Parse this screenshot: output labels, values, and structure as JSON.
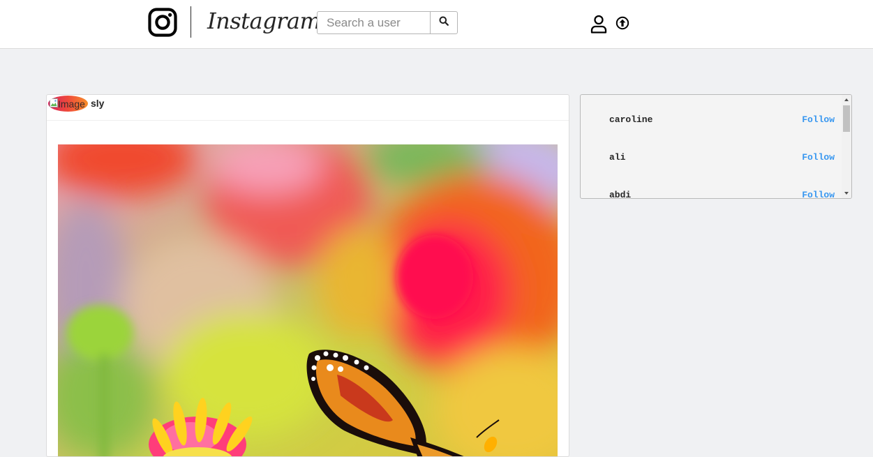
{
  "header": {
    "brand": "Instagram",
    "logo_icon": "instagram-camera-icon",
    "search": {
      "placeholder": "Search a user",
      "value": "",
      "button_icon": "search-icon"
    },
    "nav_icons": [
      "user-profile-icon",
      "upload-arrow-icon"
    ]
  },
  "post": {
    "avatar_alt": "Image",
    "username": "sly",
    "image_subject": "butterfly-on-flowers-photo"
  },
  "suggestions": {
    "users": [
      {
        "name": "caroline",
        "action": "Follow"
      },
      {
        "name": "ali",
        "action": "Follow"
      },
      {
        "name": "abdi",
        "action": "Follow"
      }
    ]
  },
  "colors": {
    "link": "#3897f0",
    "background": "#f0f1f3",
    "text": "#262626"
  }
}
